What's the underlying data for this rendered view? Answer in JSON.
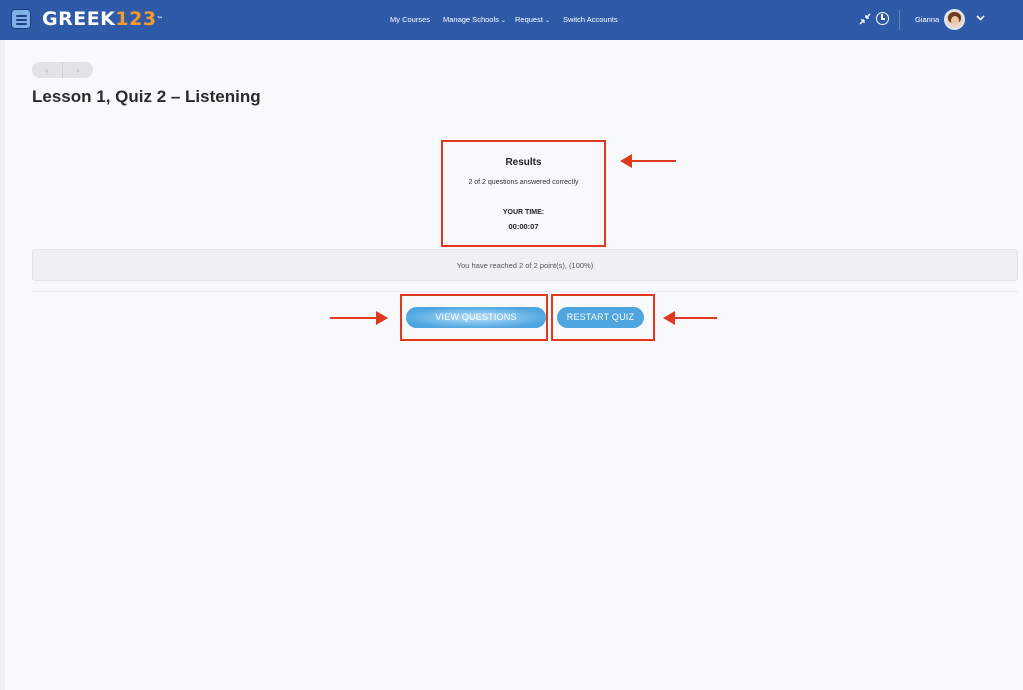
{
  "header": {
    "logo_text": "GREEK",
    "logo_num": "123",
    "logo_mark": "™",
    "nav": [
      {
        "label": "My Courses",
        "has_dropdown": false
      },
      {
        "label": "Manage Schools",
        "has_dropdown": true
      },
      {
        "label": "Request",
        "has_dropdown": true
      },
      {
        "label": "Switch Accounts",
        "has_dropdown": false
      }
    ],
    "caret": "⌄",
    "user_name": "Gianna",
    "icons": [
      "menu-icon",
      "collapse-icon",
      "clock-icon",
      "avatar",
      "chevron-down-icon"
    ],
    "bar_color": "#2e5aa8",
    "logo_accent_color": "#f29a2e"
  },
  "pager": {
    "prev": "‹",
    "next": "›"
  },
  "page_title": "Lesson 1, Quiz 2 – Listening",
  "results": {
    "title": "Results",
    "summary": "2 of 2 questions answered correctly",
    "time_label": "YOUR TIME:",
    "time_value": "00:00:07"
  },
  "score": {
    "text": "You have reached 2 of 2 point(s), (100%)"
  },
  "buttons": {
    "view_questions": "VIEW QUESTIONS",
    "restart_quiz": "RESTART QUIZ",
    "color": "#4ea5e0"
  },
  "annotations": {
    "color": "#e0391f"
  }
}
